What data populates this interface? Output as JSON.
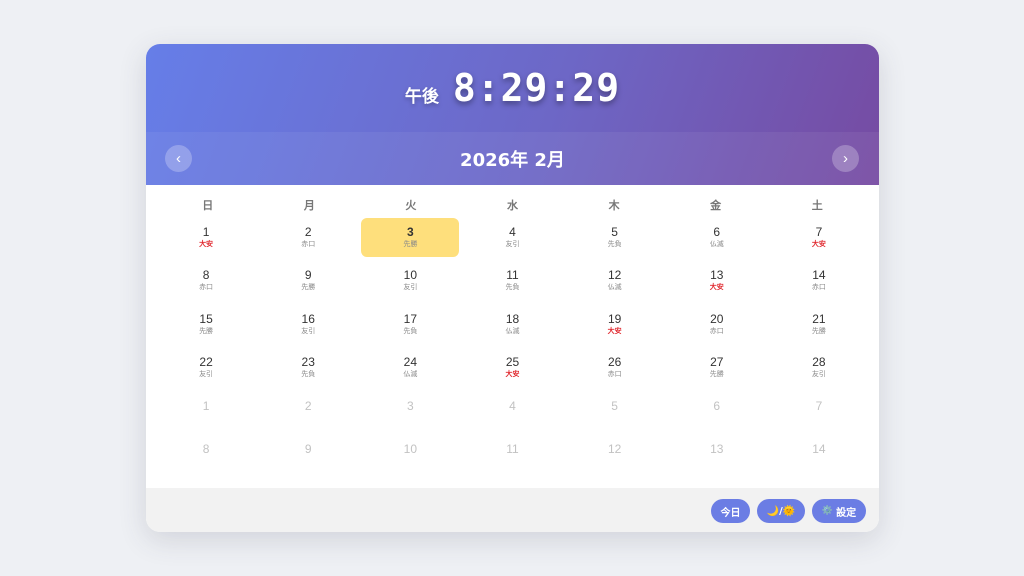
{
  "clock": {
    "ampm": "午後",
    "time": "8:29:29"
  },
  "calendar": {
    "month_title": "2026年 2月",
    "prev_label": "‹",
    "next_label": "›",
    "weekdays": [
      "日",
      "月",
      "火",
      "水",
      "木",
      "金",
      "土"
    ],
    "today_day": 3,
    "weeks": [
      [
        {
          "day": "1",
          "rokuyo": "大安"
        },
        {
          "day": "2",
          "rokuyo": "赤口"
        },
        {
          "day": "3",
          "rokuyo": "先勝"
        },
        {
          "day": "4",
          "rokuyo": "友引"
        },
        {
          "day": "5",
          "rokuyo": "先負"
        },
        {
          "day": "6",
          "rokuyo": "仏滅"
        },
        {
          "day": "7",
          "rokuyo": "大安"
        }
      ],
      [
        {
          "day": "8",
          "rokuyo": "赤口"
        },
        {
          "day": "9",
          "rokuyo": "先勝"
        },
        {
          "day": "10",
          "rokuyo": "友引"
        },
        {
          "day": "11",
          "rokuyo": "先負"
        },
        {
          "day": "12",
          "rokuyo": "仏滅"
        },
        {
          "day": "13",
          "rokuyo": "大安"
        },
        {
          "day": "14",
          "rokuyo": "赤口"
        }
      ],
      [
        {
          "day": "15",
          "rokuyo": "先勝"
        },
        {
          "day": "16",
          "rokuyo": "友引"
        },
        {
          "day": "17",
          "rokuyo": "先負"
        },
        {
          "day": "18",
          "rokuyo": "仏滅"
        },
        {
          "day": "19",
          "rokuyo": "大安"
        },
        {
          "day": "20",
          "rokuyo": "赤口"
        },
        {
          "day": "21",
          "rokuyo": "先勝"
        }
      ],
      [
        {
          "day": "22",
          "rokuyo": "友引"
        },
        {
          "day": "23",
          "rokuyo": "先負"
        },
        {
          "day": "24",
          "rokuyo": "仏滅"
        },
        {
          "day": "25",
          "rokuyo": "大安"
        },
        {
          "day": "26",
          "rokuyo": "赤口"
        },
        {
          "day": "27",
          "rokuyo": "先勝"
        },
        {
          "day": "28",
          "rokuyo": "友引"
        }
      ],
      [
        {
          "day": "1",
          "rokuyo": "",
          "other": true
        },
        {
          "day": "2",
          "rokuyo": "",
          "other": true
        },
        {
          "day": "3",
          "rokuyo": "",
          "other": true
        },
        {
          "day": "4",
          "rokuyo": "",
          "other": true
        },
        {
          "day": "5",
          "rokuyo": "",
          "other": true
        },
        {
          "day": "6",
          "rokuyo": "",
          "other": true
        },
        {
          "day": "7",
          "rokuyo": "",
          "other": true
        }
      ],
      [
        {
          "day": "8",
          "rokuyo": "",
          "other": true
        },
        {
          "day": "9",
          "rokuyo": "",
          "other": true
        },
        {
          "day": "10",
          "rokuyo": "",
          "other": true
        },
        {
          "day": "11",
          "rokuyo": "",
          "other": true
        },
        {
          "day": "12",
          "rokuyo": "",
          "other": true
        },
        {
          "day": "13",
          "rokuyo": "",
          "other": true
        },
        {
          "day": "14",
          "rokuyo": "",
          "other": true
        }
      ]
    ]
  },
  "footer": {
    "today_label": "今日",
    "theme_label": "🌙/🌞",
    "settings_icon": "⚙️",
    "settings_label": "設定"
  },
  "colors": {
    "header_start": "#667ee8",
    "header_end": "#764ba2",
    "today_highlight": "#fedf7c",
    "taian_red": "#e0282e",
    "button_blue": "#6b7de4"
  }
}
